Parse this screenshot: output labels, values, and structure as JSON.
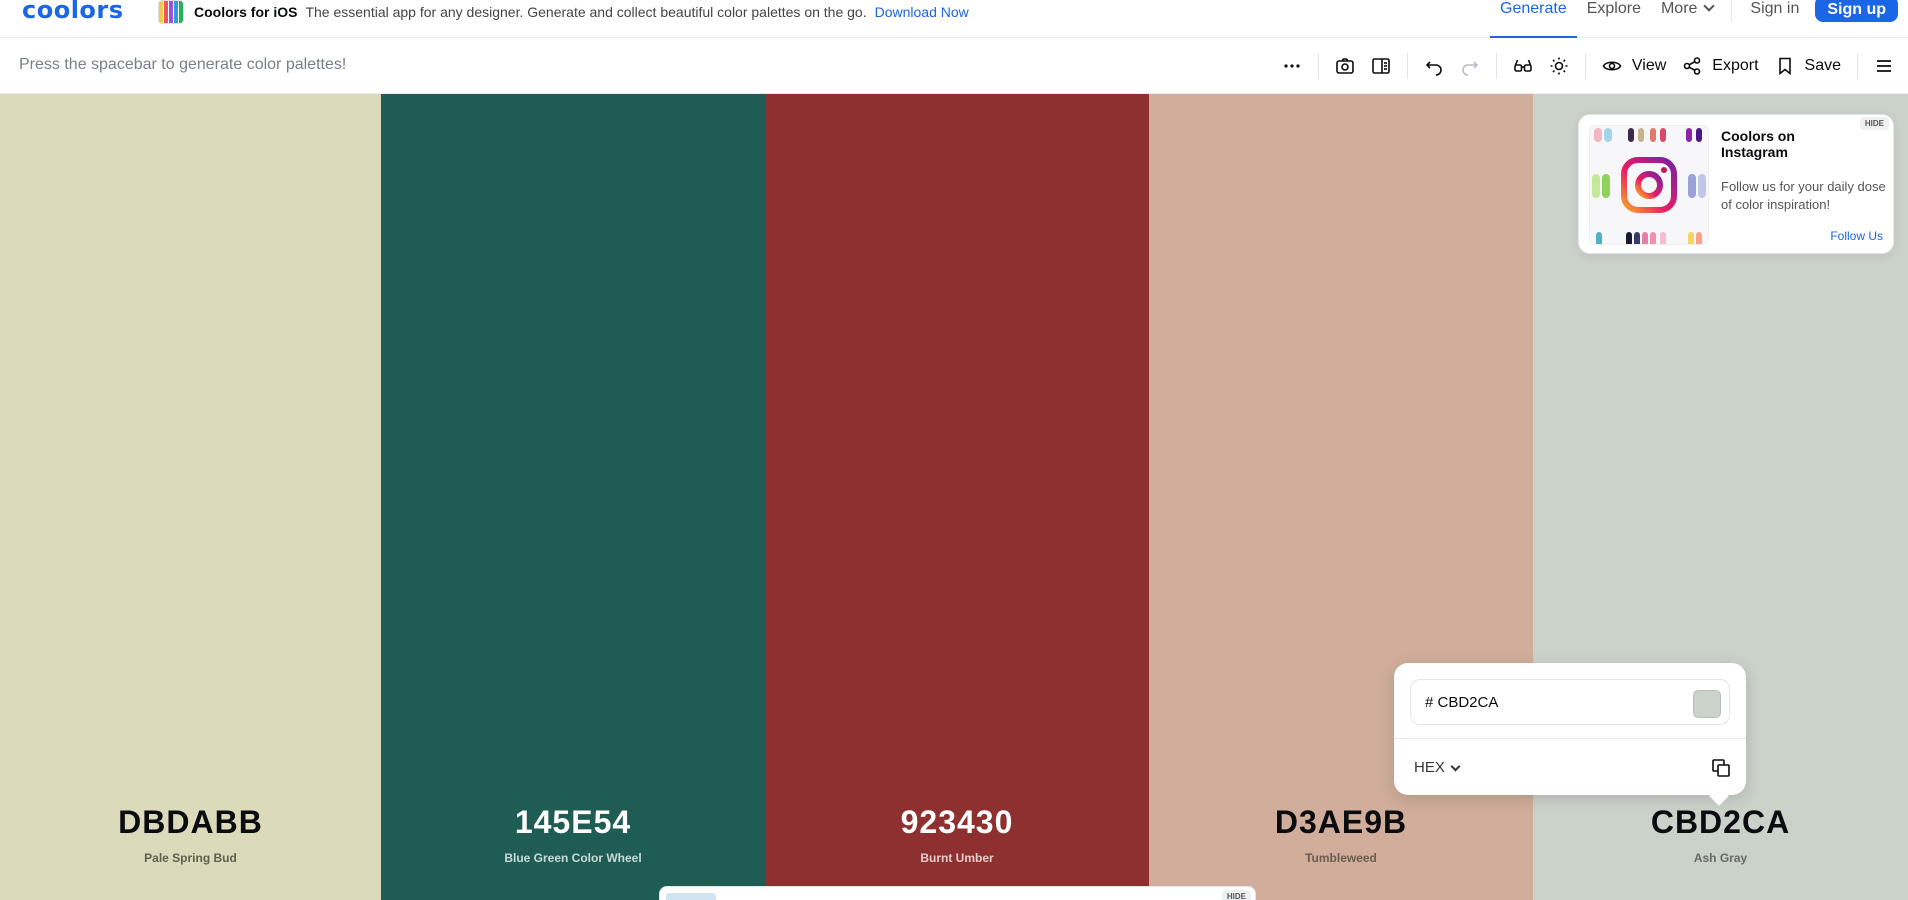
{
  "app": {
    "logo": "coolors",
    "promo": {
      "title": "Coolors for iOS",
      "text": "The essential app for any designer. Generate and collect beautiful color palettes on the go.",
      "link": "Download Now"
    },
    "nav": {
      "generate": "Generate",
      "explore": "Explore",
      "more": "More",
      "signin": "Sign in",
      "signup": "Sign up"
    }
  },
  "toolbar": {
    "hint": "Press the spacebar to generate color palettes!",
    "view": "View",
    "export": "Export",
    "save": "Save"
  },
  "palette": [
    {
      "hex": "DBDABB",
      "name": "Pale Spring Bud",
      "color": "#DBDABB",
      "text_color": "#0a0c10",
      "name_color": "#5f5e4f"
    },
    {
      "hex": "145E54",
      "name": "Blue Green Color Wheel",
      "color": "#1F5C54",
      "text_color": "#ffffff",
      "name_color": "#c9dbd8"
    },
    {
      "hex": "923430",
      "name": "Burnt Umber",
      "color": "#8E2F30",
      "text_color": "#ffffff",
      "name_color": "#e8cccb"
    },
    {
      "hex": "D3AE9B",
      "name": "Tumbleweed",
      "color": "#D0AE9B",
      "text_color": "#0a0c10",
      "name_color": "#6b5a50"
    },
    {
      "hex": "CBD2CA",
      "name": "Ash Gray",
      "color": "#CBD2CA",
      "text_color": "#0a0c10",
      "name_color": "#646a63"
    }
  ],
  "instagram": {
    "title": "Coolors on Instagram",
    "text": "Follow us for your daily dose of color inspiration!",
    "link": "Follow Us",
    "hide": "HIDE"
  },
  "picker": {
    "value": "# CBD2CA",
    "mode": "HEX",
    "swatch_color": "#CBD2CA"
  },
  "bottom_ad": {
    "hide": "HIDE"
  },
  "colors": {
    "accent": "#1b66e6"
  }
}
